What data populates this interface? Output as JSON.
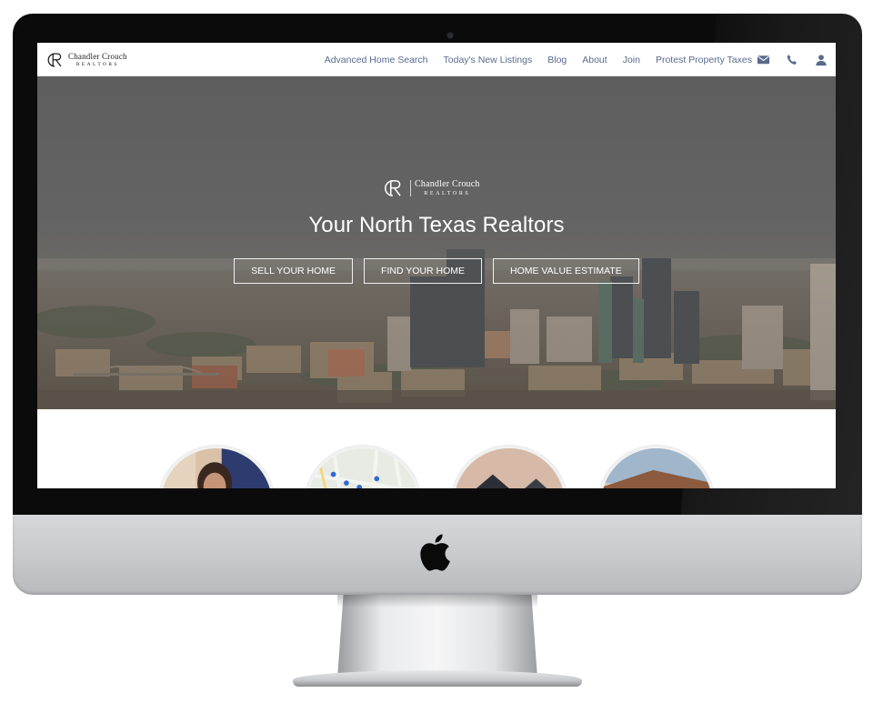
{
  "brand": {
    "name": "Chandler Crouch",
    "sub": "REALTORS",
    "monogram": "CR"
  },
  "nav": {
    "links": [
      "Advanced Home Search",
      "Today's New Listings",
      "Blog",
      "About",
      "Join",
      "Protest Property Taxes"
    ],
    "icons": [
      "envelope-icon",
      "phone-icon",
      "user-icon"
    ]
  },
  "hero": {
    "title": "Your North Texas Realtors",
    "buttons": [
      "SELL YOUR HOME",
      "FIND YOUR HOME",
      "HOME VALUE ESTIMATE"
    ]
  },
  "features": {
    "circles": [
      "agent-photo",
      "map-image",
      "modern-home-image",
      "villa-home-image"
    ]
  },
  "colors": {
    "nav_link": "#5a6a8e",
    "hero_overlay": "#6a6a6a",
    "bezel": "#0b0b0c"
  }
}
